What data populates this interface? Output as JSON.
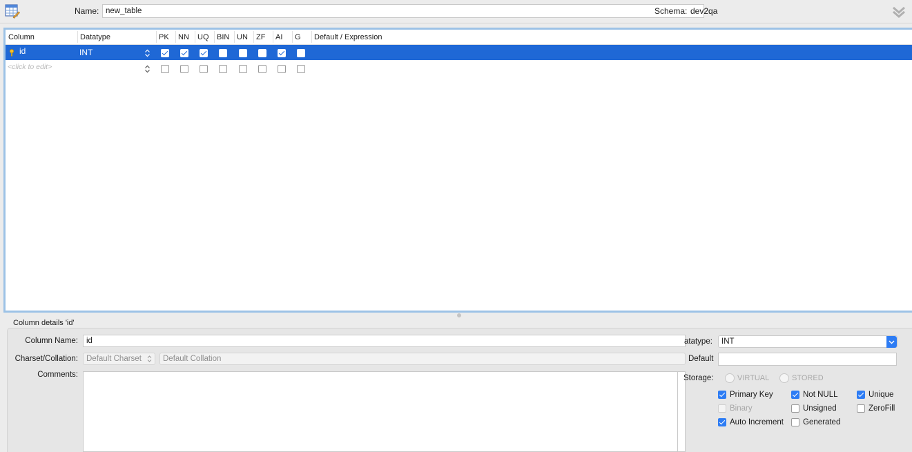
{
  "header": {
    "name_label": "Name:",
    "name_value": "new_table",
    "schema_label": "Schema:",
    "schema_value": "dev2qa"
  },
  "grid": {
    "columns": [
      "Column",
      "Datatype",
      "PK",
      "NN",
      "UQ",
      "BIN",
      "UN",
      "ZF",
      "AI",
      "G",
      "Default / Expression"
    ],
    "rows": [
      {
        "name": "id",
        "datatype": "INT",
        "pk": true,
        "nn": true,
        "uq": true,
        "bin": false,
        "un": false,
        "zf": false,
        "ai": true,
        "g": false,
        "default": "",
        "selected": true
      },
      {
        "name": "<click to edit>",
        "datatype": "",
        "pk": false,
        "nn": false,
        "uq": false,
        "bin": false,
        "un": false,
        "zf": false,
        "ai": false,
        "g": false,
        "default": "",
        "selected": false
      }
    ]
  },
  "details": {
    "title": "Column details 'id'",
    "column_name_label": "Column Name:",
    "column_name_value": "id",
    "datatype_label": "atatype:",
    "datatype_value": "INT",
    "charset_label": "Charset/Collation:",
    "charset_value": "Default Charset",
    "collation_value": "Default Collation",
    "default_label": "Default",
    "default_value": "",
    "comments_label": "Comments:",
    "comments_value": "",
    "storage_label": "Storage:",
    "storage_options": [
      "VIRTUAL",
      "STORED"
    ],
    "flags": {
      "primary_key": {
        "label": "Primary Key",
        "checked": true
      },
      "not_null": {
        "label": "Not NULL",
        "checked": true
      },
      "unique": {
        "label": "Unique",
        "checked": true
      },
      "binary": {
        "label": "Binary",
        "checked": false,
        "disabled": true
      },
      "unsigned": {
        "label": "Unsigned",
        "checked": false
      },
      "zerofill": {
        "label": "ZeroFill",
        "checked": false
      },
      "auto_increment": {
        "label": "Auto Increment",
        "checked": true
      },
      "generated": {
        "label": "Generated",
        "checked": false
      }
    }
  },
  "colors": {
    "selection": "#1f68d6",
    "checkbox_accent": "#2d7cf4",
    "grid_border": "#9cc2e6"
  }
}
